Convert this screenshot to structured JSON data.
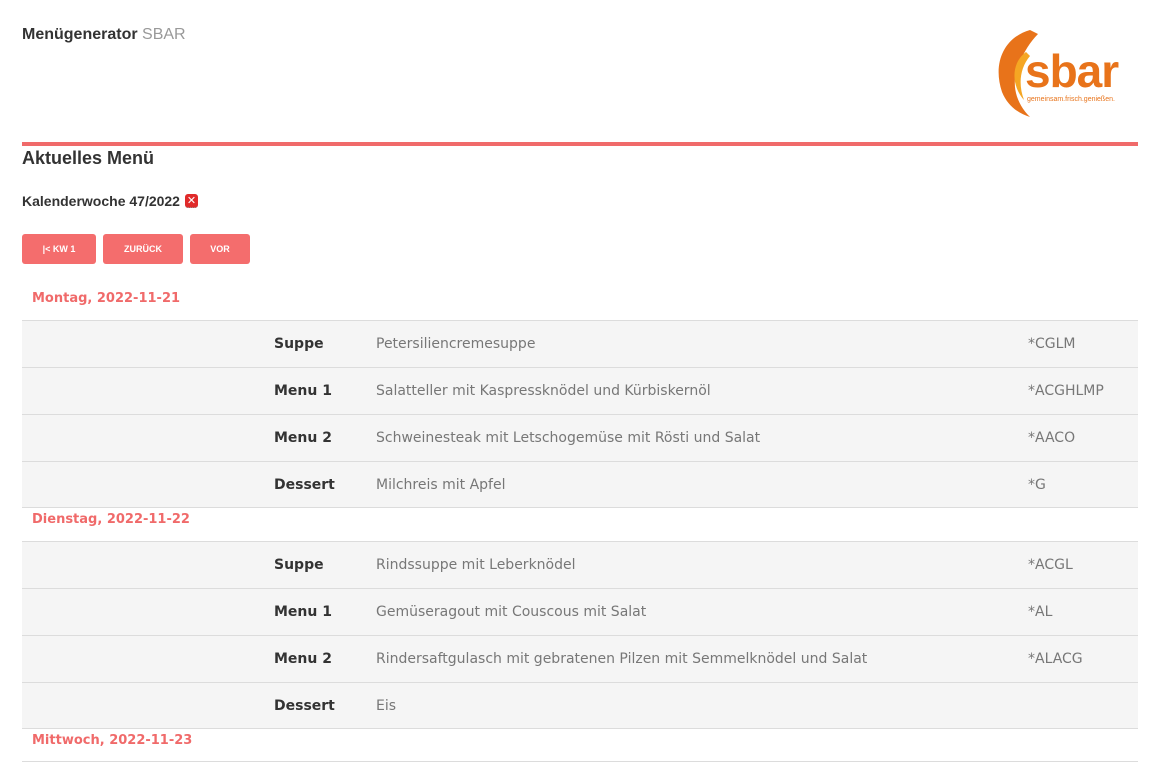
{
  "header": {
    "brand_bold": "Menügenerator",
    "brand_sub": "SBAR",
    "logo_text": "sbar",
    "logo_tagline": "gemeinsam.frisch.genießen."
  },
  "page_title": "Aktuelles Menü",
  "week_label": "Kalenderwoche 47/2022",
  "nav": {
    "first_label": "|< KW 1",
    "back_label": "ZURÜCK",
    "next_label": "VOR"
  },
  "colors": {
    "accent": "#f06a6a",
    "button": "#f46d6d",
    "logo_orange": "#e8731a",
    "row_bg": "#f5f5f5"
  },
  "days": [
    {
      "label": "Montag, 2022-11-21",
      "items": [
        {
          "category": "Suppe",
          "dish": "Petersiliencremesuppe",
          "code": "*CGLM"
        },
        {
          "category": "Menu 1",
          "dish": "Salatteller mit Kaspressknödel und Kürbiskernöl",
          "code": "*ACGHLMP"
        },
        {
          "category": "Menu 2",
          "dish": "Schweinesteak mit Letschogemüse mit Rösti und Salat",
          "code": "*AACO"
        },
        {
          "category": "Dessert",
          "dish": "Milchreis mit Apfel",
          "code": "*G"
        }
      ]
    },
    {
      "label": "Dienstag, 2022-11-22",
      "items": [
        {
          "category": "Suppe",
          "dish": "Rindssuppe mit Leberknödel",
          "code": "*ACGL"
        },
        {
          "category": "Menu 1",
          "dish": "Gemüseragout mit Couscous mit Salat",
          "code": "*AL"
        },
        {
          "category": "Menu 2",
          "dish": "Rindersaftgulasch mit gebratenen Pilzen mit Semmelknödel und Salat",
          "code": "*ALACG"
        },
        {
          "category": "Dessert",
          "dish": "Eis",
          "code": ""
        }
      ]
    },
    {
      "label": "Mittwoch, 2022-11-23",
      "items": []
    }
  ]
}
